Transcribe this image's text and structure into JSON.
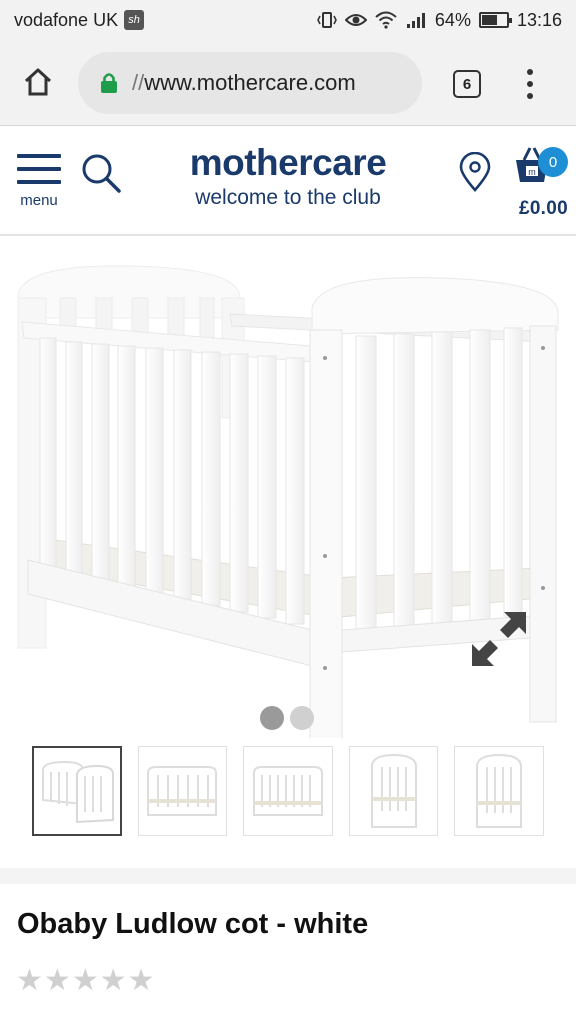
{
  "status_bar": {
    "carrier": "vodafone UK",
    "carrier_badge": "sh",
    "battery_percent": "64%",
    "battery_level": 0.64,
    "time": "13:16"
  },
  "browser": {
    "url_prefix": "//",
    "url_host": "www.mothercare.com",
    "tab_count": "6",
    "icons": {
      "home": "home-icon",
      "secure": "lock-icon",
      "tabs": "tabs-icon",
      "more": "more-vert-icon"
    }
  },
  "header": {
    "menu_label": "menu",
    "logo_main": "mothercare",
    "logo_tagline": "welcome to the club",
    "basket_count": "0",
    "basket_total": "£0.00",
    "brand_color": "#1a3a6b",
    "badge_color": "#1e8fd4"
  },
  "gallery": {
    "image_count": 2,
    "active_index": 0,
    "thumbnail_count": 5,
    "selected_thumbnail": 0
  },
  "product": {
    "title": "Obaby Ludlow cot - white",
    "rating_stars_filled": 0,
    "rating_stars_total": 5,
    "star_glyph": "★"
  }
}
